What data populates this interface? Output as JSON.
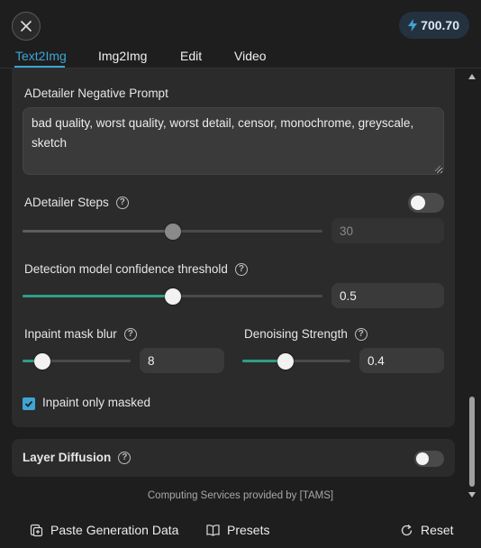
{
  "header": {
    "credits": "700.70",
    "accent": "#3ea5d6",
    "slider_color": "#2f9e86"
  },
  "tabs": [
    {
      "label": "Text2Img",
      "active": true
    },
    {
      "label": "Img2Img",
      "active": false
    },
    {
      "label": "Edit",
      "active": false
    },
    {
      "label": "Video",
      "active": false
    }
  ],
  "adetailer": {
    "negative_prompt_label": "ADetailer Negative Prompt",
    "negative_prompt_value": "bad quality, worst quality, worst detail, censor, monochrome, greyscale, sketch",
    "steps_label": "ADetailer Steps",
    "steps_value": "30",
    "steps_fraction": 0.5,
    "steps_enabled": false,
    "confidence_label": "Detection model confidence threshold",
    "confidence_value": "0.5",
    "confidence_fraction": 0.5,
    "mask_blur_label": "Inpaint mask blur",
    "mask_blur_value": "8",
    "mask_blur_fraction": 0.18,
    "denoising_label": "Denoising Strength",
    "denoising_value": "0.4",
    "denoising_fraction": 0.4,
    "inpaint_only_masked_label": "Inpaint only masked",
    "inpaint_only_masked_checked": true
  },
  "layer_diffusion": {
    "label": "Layer Diffusion",
    "enabled": false
  },
  "footer": {
    "note": "Computing Services provided by [TAMS]",
    "paste_label": "Paste Generation Data",
    "presets_label": "Presets",
    "reset_label": "Reset"
  }
}
